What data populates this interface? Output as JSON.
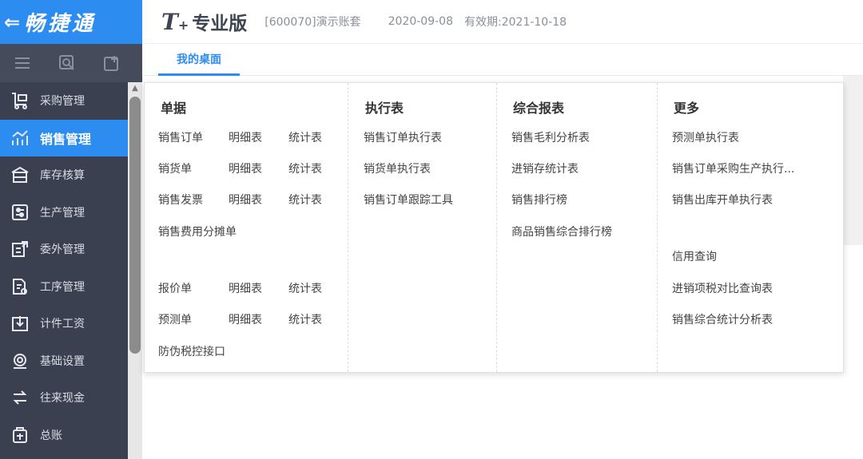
{
  "brand": {
    "back_icon": "back-arrow-icon",
    "name": "畅捷通"
  },
  "header": {
    "product_t": "T",
    "product_plus": "+",
    "product_edition": "专业版",
    "account": "[600070]演示账套",
    "date": "2020-09-08",
    "valid": "有效期:2021-10-18"
  },
  "tabs": [
    {
      "label": "我的桌面"
    }
  ],
  "sidebar": {
    "tools": [
      "menu-icon",
      "search-icon",
      "add-icon"
    ],
    "items": [
      {
        "label": "采购管理",
        "icon": "cart-icon"
      },
      {
        "label": "销售管理",
        "icon": "sales-chart-icon",
        "active": true
      },
      {
        "label": "库存核算",
        "icon": "inventory-icon"
      },
      {
        "label": "生产管理",
        "icon": "production-icon"
      },
      {
        "label": "委外管理",
        "icon": "outsource-icon"
      },
      {
        "label": "工序管理",
        "icon": "process-icon"
      },
      {
        "label": "计件工资",
        "icon": "piecework-icon"
      },
      {
        "label": "基础设置",
        "icon": "settings-icon"
      },
      {
        "label": "往来现金",
        "icon": "exchange-icon"
      },
      {
        "label": "总账",
        "icon": "ledger-icon"
      }
    ]
  },
  "panel": {
    "documents": {
      "title": "单据",
      "rows": [
        [
          "销售订单",
          "明细表",
          "统计表"
        ],
        [
          "销货单",
          "明细表",
          "统计表"
        ],
        [
          "销售发票",
          "明细表",
          "统计表"
        ],
        [
          "销售费用分摊单"
        ],
        [
          "报价单",
          "明细表",
          "统计表"
        ],
        [
          "预测单",
          "明细表",
          "统计表"
        ],
        [
          "防伪税控接口"
        ]
      ]
    },
    "execution": {
      "title": "执行表",
      "items": [
        "销售订单执行表",
        "销货单执行表",
        "销售订单跟踪工具"
      ]
    },
    "reports": {
      "title": "综合报表",
      "items": [
        "销售毛利分析表",
        "进销存统计表",
        "销售排行榜",
        "商品销售综合排行榜"
      ]
    },
    "more": {
      "title": "更多",
      "items": [
        "预测单执行表",
        "销售订单采购生产执行...",
        "销售出库开单执行表",
        "信用查询",
        "进销项税对比查询表",
        "销售综合统计分析表"
      ]
    }
  },
  "colors": {
    "accent": "#2d8cf0",
    "sidebar": "#3a404f"
  }
}
